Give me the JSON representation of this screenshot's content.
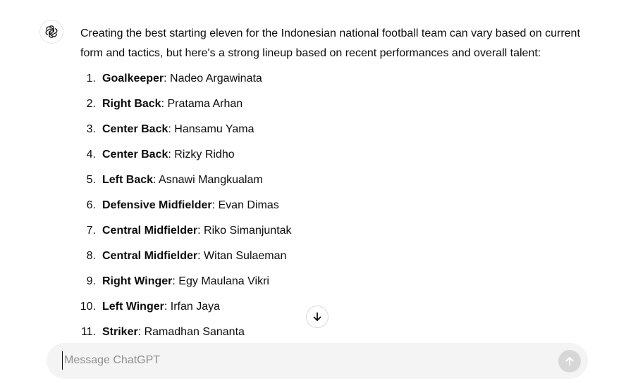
{
  "conversation": {
    "assistant_icon": "openai-logo-icon",
    "intro": "Creating the best starting eleven for the Indonesian national football team can vary based on current form and tactics, but here's a strong lineup based on recent performances and overall talent:",
    "lineup": [
      {
        "number": "1.",
        "position": "Goalkeeper",
        "player": ": Nadeo Argawinata"
      },
      {
        "number": "2.",
        "position": "Right Back",
        "player": ": Pratama Arhan"
      },
      {
        "number": "3.",
        "position": "Center Back",
        "player": ": Hansamu Yama"
      },
      {
        "number": "4.",
        "position": "Center Back",
        "player": ": Rizky Ridho"
      },
      {
        "number": "5.",
        "position": "Left Back",
        "player": ": Asnawi Mangkualam"
      },
      {
        "number": "6.",
        "position": "Defensive Midfielder",
        "player": ": Evan Dimas"
      },
      {
        "number": "7.",
        "position": "Central Midfielder",
        "player": ": Riko Simanjuntak"
      },
      {
        "number": "8.",
        "position": "Central Midfielder",
        "player": ": Witan Sulaeman"
      },
      {
        "number": "9.",
        "position": "Right Winger",
        "player": ": Egy Maulana Vikri"
      },
      {
        "number": "10.",
        "position": "Left Winger",
        "player": ": Irfan Jaya"
      },
      {
        "number": "11.",
        "position": "Striker",
        "player": ": Ramadhan Sananta"
      }
    ]
  },
  "scroll_button": {
    "icon": "arrow-down-icon"
  },
  "composer": {
    "placeholder": "Message ChatGPT",
    "value": "",
    "send_icon": "arrow-up-icon"
  },
  "colors": {
    "background": "#ffffff",
    "composer_bg": "#f4f4f4",
    "send_button_disabled": "#d7d7d7",
    "text": "#0d0d0d"
  }
}
